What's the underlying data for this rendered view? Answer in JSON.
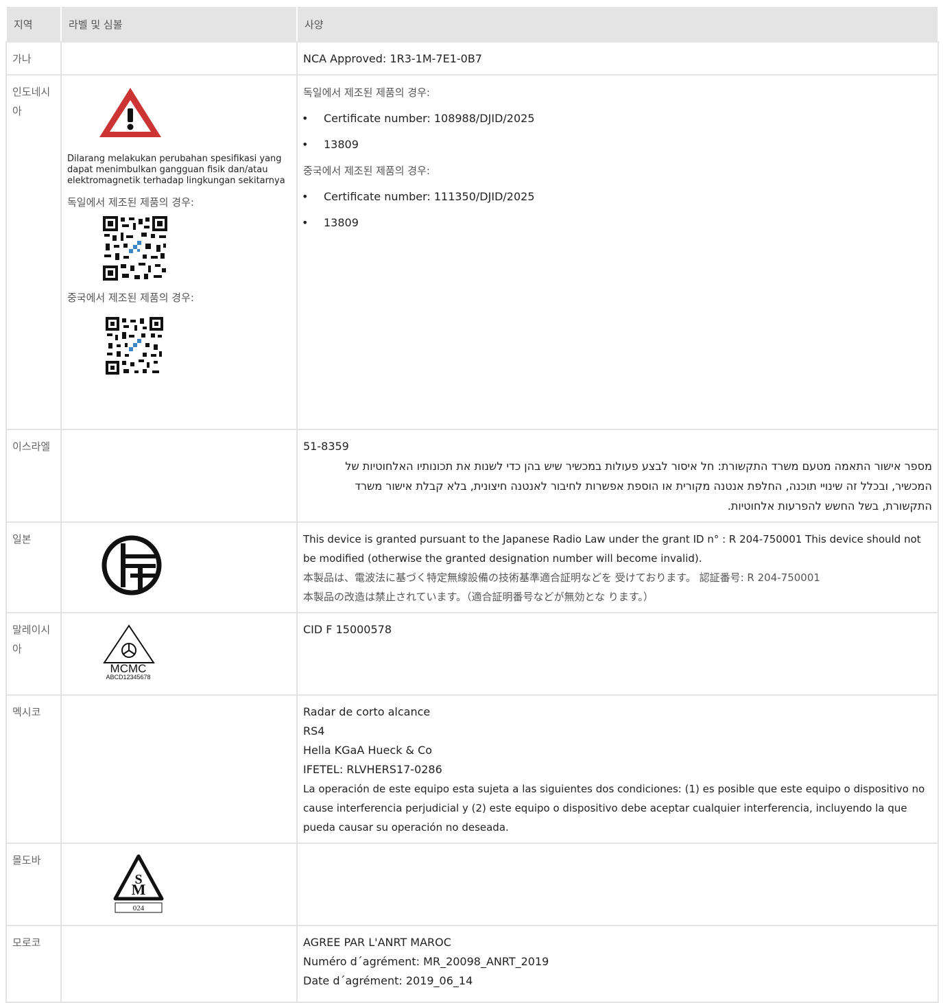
{
  "header": {
    "col_region": "지역",
    "col_label": "라벨 및 심볼",
    "col_spec": "사양"
  },
  "rows": {
    "ghana": {
      "region": "가나",
      "spec": "NCA Approved: 1R3-1M-7E1-0B7"
    },
    "indonesia": {
      "region": "인도네시아",
      "warning_text": "Dilarang melakukan perubahan spesifikasi yang dapat menimbulkan gangguan fisik dan/atau elektromagnetik terhadap lingkungan sekitarnya",
      "label_germany": "독일에서 제조된 제품의 경우:",
      "label_china": "중국에서 제조된 제품의 경우:",
      "spec_germany_heading": "독일에서 제조된 제품의 경우:",
      "spec_germany_cert": "Certificate number: 108988/DJID/2025",
      "spec_germany_num": "13809",
      "spec_china_heading": "중국에서 제조된 제품의 경우:",
      "spec_china_cert": "Certificate number: 111350/DJID/2025",
      "spec_china_num": "13809"
    },
    "israel": {
      "region": "이스라엘",
      "number": "51-8359",
      "text": "מספר אישור התאמה מטעם משרד התקשורת: חל איסור לבצע פעולות במכשיר שיש בהן כדי לשנות את תכונותיו האלחוטיות של המכשיר, ובכלל זה שינויי תוכנה, החלפת אנטנה מקורית או הוספת אפשרות לחיבור לאנטנה חיצונית, בלא קבלת אישור משרד התקשורת, בשל החשש להפרעות אלחוטיות."
    },
    "japan": {
      "region": "일본",
      "en": "This device is granted pursuant to the Japanese Radio Law under the grant ID n° : R 204-750001 This device should not be modified (otherwise the granted designation number will become invalid).",
      "jp1": "本製品は、電波法に基づく特定無線設備の技術基準適合証明などを 受けております。 認証番号: R 204-750001",
      "jp2": "本製品の改造は禁止されています。（適合証明番号などが無効とな ります。）"
    },
    "malaysia": {
      "region": "말레이시아",
      "logo_text": "MCMC",
      "logo_code": "ABCD12345678",
      "spec": "CID F 15000578"
    },
    "mexico": {
      "region": "멕시코",
      "line1": "Radar de corto alcance",
      "line2": "RS4",
      "line3": "Hella KGaA Hueck & Co",
      "line4": "IFETEL: RLVHERS17-0286",
      "line5": "La operación de este equipo esta sujeta a las siguientes dos condiciones: (1) es posible que este equipo o dispositivo no cause interferencia perjudicial y (2) este equipo o dispositivo debe aceptar cualquier interferencia, incluyendo la que pueda causar su operación no deseada."
    },
    "moldova": {
      "region": "몰도바",
      "logo_code": "024"
    },
    "morocco": {
      "region": "모로코",
      "line1": "AGREE PAR L'ANRT MAROC",
      "line2": "Numéro d´agrément: MR_20098_ANRT_2019",
      "line3": "Date d´agrément: 2019_06_14"
    }
  },
  "colors": {
    "header_bg": "#e4e4e4",
    "warning_red": "#cc3333",
    "grid": "#e4e4e4"
  }
}
